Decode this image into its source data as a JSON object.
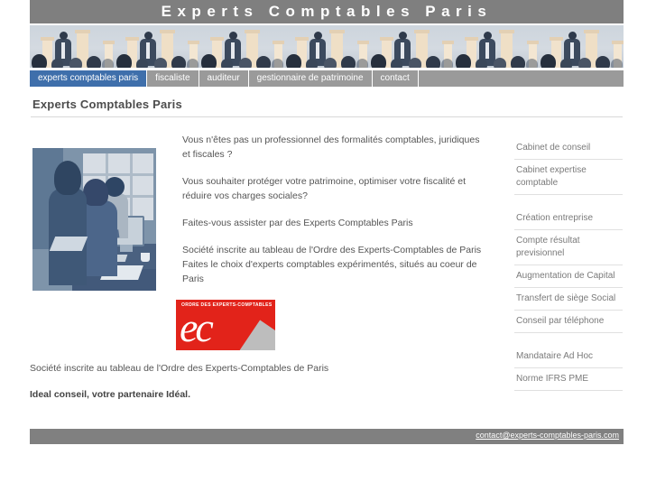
{
  "header": {
    "site_title": "Experts Comptables Paris"
  },
  "banner": {
    "alt": "bandeau professionnels"
  },
  "nav": {
    "items": [
      {
        "label": "experts comptables paris",
        "active": true
      },
      {
        "label": "fiscaliste",
        "active": false
      },
      {
        "label": "auditeur",
        "active": false
      },
      {
        "label": "gestionnaire de patrimoine",
        "active": false
      },
      {
        "label": "contact",
        "active": false
      }
    ]
  },
  "main": {
    "page_title": "Experts Comptables Paris",
    "paragraphs": [
      "Vous n'êtes pas un professionnel des formalités comptables, juridiques et fiscales ?",
      "Vous souhaiter protéger votre patrimoine, optimiser votre fiscalité et réduire vos charges sociales?",
      "Faites-vous assister par des Experts Comptables Paris",
      "Société inscrite au tableau de l'Ordre des Experts-Comptables de Paris Faites le choix d'experts comptables expérimentés, situés au coeur de Paris"
    ],
    "note": "Société inscrite au tableau de l'Ordre des Experts-Comptables de Paris",
    "slogan": "Ideal conseil, votre partenaire Idéal."
  },
  "logo": {
    "caption": "ORDRE DES EXPERTS-COMPTABLES",
    "mark": "ec"
  },
  "sidebar": {
    "groups": [
      {
        "links": [
          "Cabinet de conseil",
          "Cabinet expertise comptable"
        ]
      },
      {
        "links": [
          "Création entreprise",
          "Compte résultat previsionnel",
          "Augmentation de Capital",
          "Transfert de siège Social",
          "Conseil par téléphone"
        ]
      },
      {
        "links": [
          "Mandataire Ad Hoc",
          "Norme IFRS PME"
        ]
      }
    ]
  },
  "footer": {
    "email": "contact@experts-comptables-paris.com"
  },
  "colors": {
    "header_gray": "#7f7f7f",
    "nav_gray": "#9a9a9a",
    "nav_active_blue": "#3f6fab",
    "footer_gray": "#808080",
    "text_gray": "#555555",
    "logo_red": "#e2231a"
  }
}
